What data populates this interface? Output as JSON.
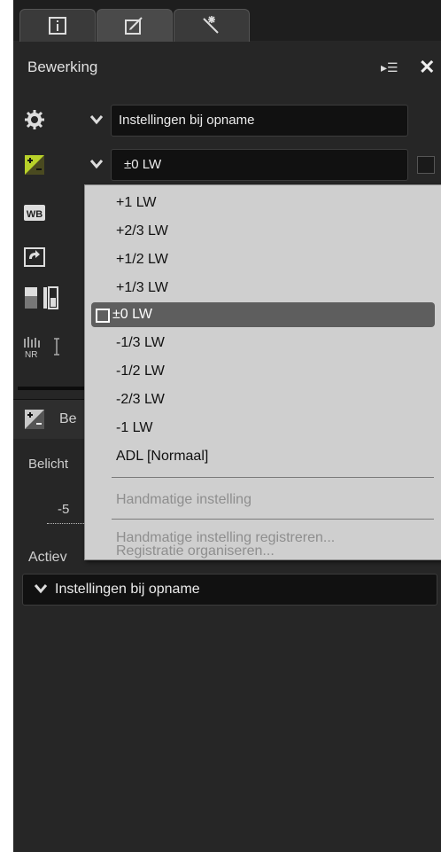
{
  "panel": {
    "title": "Bewerking",
    "tabs": [
      {
        "name": "info",
        "icon": "info-icon"
      },
      {
        "name": "edit",
        "icon": "edit-icon"
      },
      {
        "name": "effects",
        "icon": "magic-wand-icon"
      }
    ],
    "menu_icon": "▸☰",
    "close_icon": "✕"
  },
  "rows": {
    "settings_select": "Instellingen bij opname",
    "exposure_select": "±0 LW"
  },
  "partial": {
    "subheader": "Be",
    "belicht_label": "Belicht",
    "slider_tick": "-5",
    "active_label": "Actiev",
    "bottom_select": "Instellingen bij opname"
  },
  "dropdown": {
    "options": [
      {
        "label": "+1 LW"
      },
      {
        "label": "+2/3 LW"
      },
      {
        "label": "+1/2 LW"
      },
      {
        "label": "+1/3 LW"
      },
      {
        "label": "±0 LW",
        "selected": true
      },
      {
        "label": "-1/3 LW"
      },
      {
        "label": "-1/2 LW"
      },
      {
        "label": "-2/3 LW"
      },
      {
        "label": "-1 LW"
      },
      {
        "label": "ADL [Normaal]"
      }
    ],
    "manual": "Handmatige instelling",
    "register": "Handmatige instelling registreren...",
    "organize": "Registratie organiseren..."
  },
  "colors": {
    "accent_green": "#b8d12a",
    "panel_bg": "#262626",
    "dropdown_bg": "#cfcfcf",
    "selected_bg": "#5e5e5e"
  }
}
